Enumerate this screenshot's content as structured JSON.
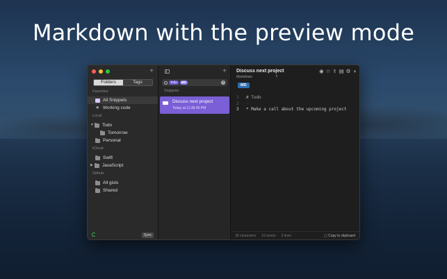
{
  "headline": "Markdown with the preview mode",
  "sidebar": {
    "tabs": [
      "Folders",
      "Tags"
    ],
    "add_icon": "+",
    "sections": {
      "favorites": "Favorites",
      "local": "Local",
      "icloud": "iCloud",
      "github": "Github"
    },
    "items": {
      "all_snippets": "All Snippets",
      "working_code": "Working code",
      "todo": "Todo",
      "tomorrow": "Tomorrow",
      "personal": "Personal",
      "swift": "Swift",
      "javascript": "JavaScript",
      "all_gists": "All gists",
      "shared": "Shared"
    },
    "sync_label": "Sync"
  },
  "list": {
    "add_icon": "+",
    "search_tags": [
      "Todo",
      "MD"
    ],
    "section_label": "Snippets",
    "selected_snippet": {
      "title": "Discuss next project",
      "date": "Today at 11:36:46 PM"
    }
  },
  "editor": {
    "title": "Discuss next project",
    "language": "Markdown",
    "language_chevron": "⇕",
    "badge": "MD",
    "lines": [
      {
        "num": "1",
        "text": "# Todo"
      },
      {
        "num": "2",
        "text": "-"
      },
      {
        "num": "3",
        "text": "* Make a call about the upcoming project"
      }
    ],
    "status": {
      "characters": "38 characters",
      "words": "10 words",
      "lines": "3 lines",
      "copy": "Copy to clipboard"
    },
    "tool_icons": [
      "eye-icon",
      "star-icon",
      "share-icon",
      "trash-icon",
      "gear-icon",
      "contrast-icon"
    ]
  }
}
